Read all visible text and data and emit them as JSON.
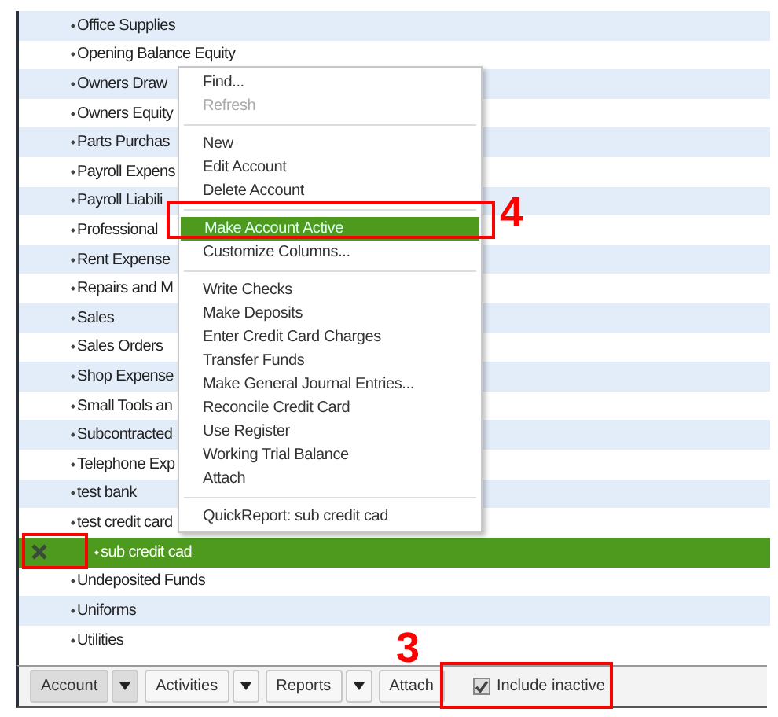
{
  "accounts": [
    {
      "name": "Office Supplies",
      "selected": false
    },
    {
      "name": "Opening Balance Equity",
      "selected": false
    },
    {
      "name": "Owners Draw",
      "selected": false
    },
    {
      "name": "Owners Equity",
      "selected": false
    },
    {
      "name": "Parts Purchas",
      "selected": false
    },
    {
      "name": "Payroll Expens",
      "selected": false
    },
    {
      "name": "Payroll Liabili",
      "selected": false
    },
    {
      "name": "Professional",
      "selected": false
    },
    {
      "name": "Rent Expense",
      "selected": false
    },
    {
      "name": "Repairs and M",
      "selected": false
    },
    {
      "name": "Sales",
      "selected": false
    },
    {
      "name": "Sales Orders",
      "selected": false
    },
    {
      "name": "Shop Expense",
      "selected": false
    },
    {
      "name": "Small Tools an",
      "selected": false
    },
    {
      "name": "Subcontracted",
      "selected": false
    },
    {
      "name": "Telephone Exp",
      "selected": false
    },
    {
      "name": "test bank",
      "selected": false
    },
    {
      "name": "test credit card",
      "selected": false
    },
    {
      "name": "sub credit cad",
      "selected": true,
      "inactive": true
    },
    {
      "name": "Undeposited Funds",
      "selected": false
    },
    {
      "name": "Uniforms",
      "selected": false
    },
    {
      "name": "Utilities",
      "selected": false
    }
  ],
  "context_menu": [
    {
      "kind": "item",
      "label": "Find...",
      "disabled": false,
      "selected": false
    },
    {
      "kind": "item",
      "label": "Refresh",
      "disabled": true,
      "selected": false
    },
    {
      "kind": "separator"
    },
    {
      "kind": "item",
      "label": "New",
      "disabled": false,
      "selected": false
    },
    {
      "kind": "item",
      "label": "Edit Account",
      "disabled": false,
      "selected": false
    },
    {
      "kind": "item",
      "label": "Delete Account",
      "disabled": false,
      "selected": false
    },
    {
      "kind": "separator"
    },
    {
      "kind": "item",
      "label": "Make Account Active",
      "disabled": false,
      "selected": true
    },
    {
      "kind": "item",
      "label": "Customize Columns...",
      "disabled": false,
      "selected": false
    },
    {
      "kind": "separator"
    },
    {
      "kind": "item",
      "label": "Write Checks",
      "disabled": false,
      "selected": false
    },
    {
      "kind": "item",
      "label": "Make Deposits",
      "disabled": false,
      "selected": false
    },
    {
      "kind": "item",
      "label": "Enter Credit Card Charges",
      "disabled": false,
      "selected": false
    },
    {
      "kind": "item",
      "label": "Transfer Funds",
      "disabled": false,
      "selected": false
    },
    {
      "kind": "item",
      "label": "Make General Journal Entries...",
      "disabled": false,
      "selected": false
    },
    {
      "kind": "item",
      "label": "Reconcile Credit Card",
      "disabled": false,
      "selected": false
    },
    {
      "kind": "item",
      "label": "Use Register",
      "disabled": false,
      "selected": false
    },
    {
      "kind": "item",
      "label": "Working Trial Balance",
      "disabled": false,
      "selected": false
    },
    {
      "kind": "item",
      "label": "Attach",
      "disabled": false,
      "selected": false
    },
    {
      "kind": "separator"
    },
    {
      "kind": "item",
      "label": "QuickReport: sub credit cad",
      "disabled": false,
      "selected": false
    }
  ],
  "toolbar": [
    {
      "kind": "dropdown",
      "label": "Account",
      "selected": true
    },
    {
      "kind": "dropdown",
      "label": "Activities",
      "selected": false
    },
    {
      "kind": "dropdown",
      "label": "Reports",
      "selected": false
    },
    {
      "kind": "button",
      "label": "Attach",
      "selected": false
    }
  ],
  "include_inactive": {
    "label": "Include inactive",
    "checked": true
  },
  "annotations": [
    {
      "kind": "menu",
      "number": "4"
    },
    {
      "kind": "row"
    },
    {
      "kind": "checkbox",
      "number": "3"
    }
  ]
}
